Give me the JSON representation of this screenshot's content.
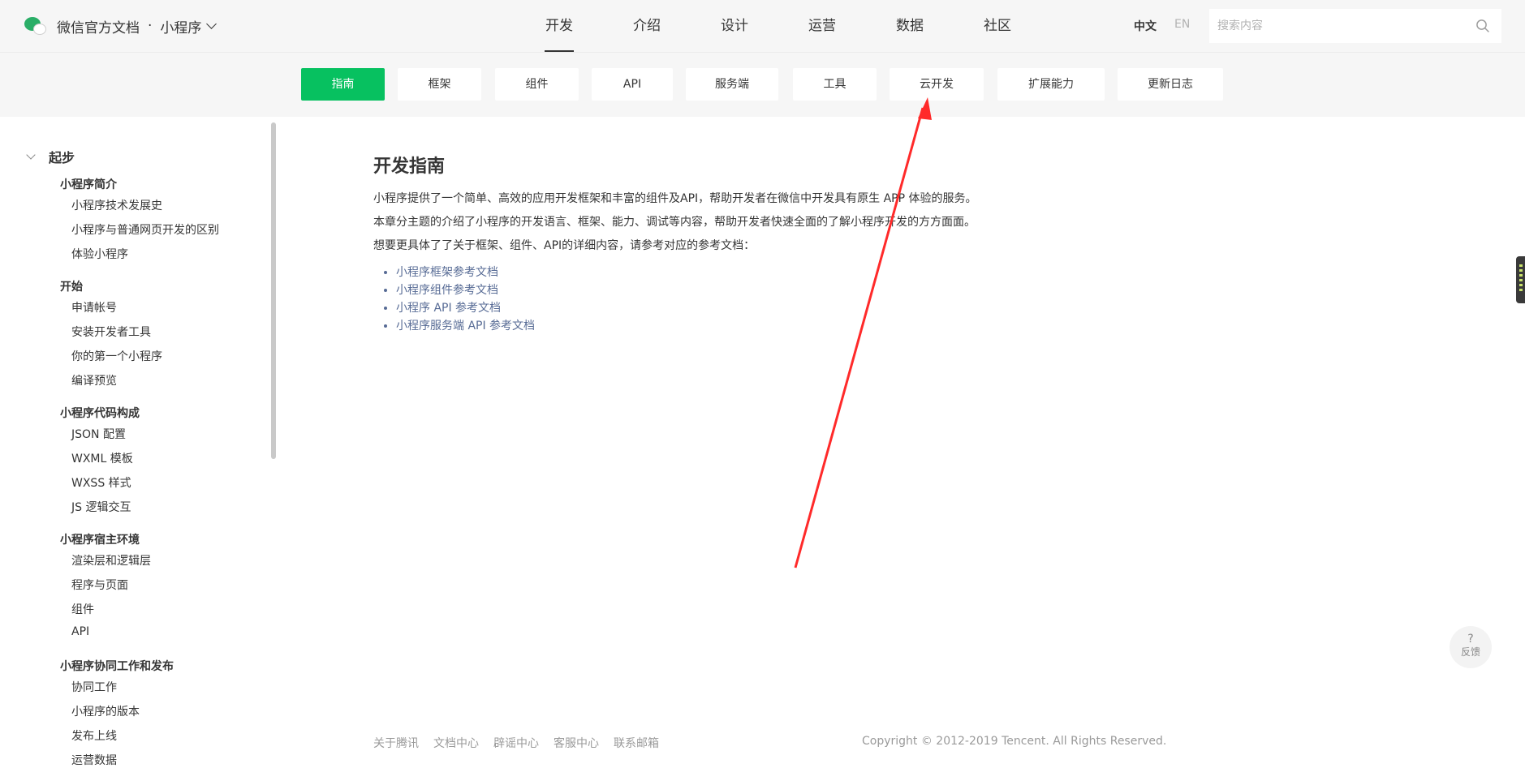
{
  "header": {
    "brand_title": "微信官方文档",
    "brand_dot": "·",
    "brand_sub": "小程序",
    "nav": [
      "开发",
      "介绍",
      "设计",
      "运营",
      "数据",
      "社区"
    ],
    "lang_zh": "中文",
    "lang_en": "EN",
    "search_placeholder": "搜索内容"
  },
  "subtabs": [
    "指南",
    "框架",
    "组件",
    "API",
    "服务端",
    "工具",
    "云开发",
    "扩展能力",
    "更新日志"
  ],
  "sidebar": {
    "section": "起步",
    "groups": [
      {
        "title": "小程序简介",
        "items": [
          "小程序技术发展史",
          "小程序与普通网页开发的区别",
          "体验小程序"
        ]
      },
      {
        "title": "开始",
        "items": [
          "申请帐号",
          "安装开发者工具",
          "你的第一个小程序",
          "编译预览"
        ]
      },
      {
        "title": "小程序代码构成",
        "items": [
          "JSON 配置",
          "WXML 模板",
          "WXSS 样式",
          "JS 逻辑交互"
        ]
      },
      {
        "title": "小程序宿主环境",
        "items": [
          "渲染层和逻辑层",
          "程序与页面",
          "组件",
          "API"
        ]
      },
      {
        "title": "小程序协同工作和发布",
        "items": [
          "协同工作",
          "小程序的版本",
          "发布上线",
          "运营数据"
        ]
      }
    ]
  },
  "content": {
    "title": "开发指南",
    "para1": "小程序提供了一个简单、高效的应用开发框架和丰富的组件及API，帮助开发者在微信中开发具有原生 APP 体验的服务。",
    "para2": "本章分主题的介绍了小程序的开发语言、框架、能力、调试等内容，帮助开发者快速全面的了解小程序开发的方方面面。",
    "para3": "想要更具体了了关于框架、组件、API的详细内容，请参考对应的参考文档：",
    "links": [
      "小程序框架参考文档",
      "小程序组件参考文档",
      "小程序 API 参考文档",
      "小程序服务端 API 参考文档"
    ]
  },
  "footer": {
    "links": [
      "关于腾讯",
      "文档中心",
      "辟谣中心",
      "客服中心",
      "联系邮箱"
    ],
    "copyright": "Copyright © 2012-2019 Tencent. All Rights Reserved."
  },
  "feedback": {
    "icon": "?",
    "label": "反馈"
  },
  "colors": {
    "accent": "#07c160",
    "link": "#576b95",
    "annotation": "#ff2a2a"
  }
}
